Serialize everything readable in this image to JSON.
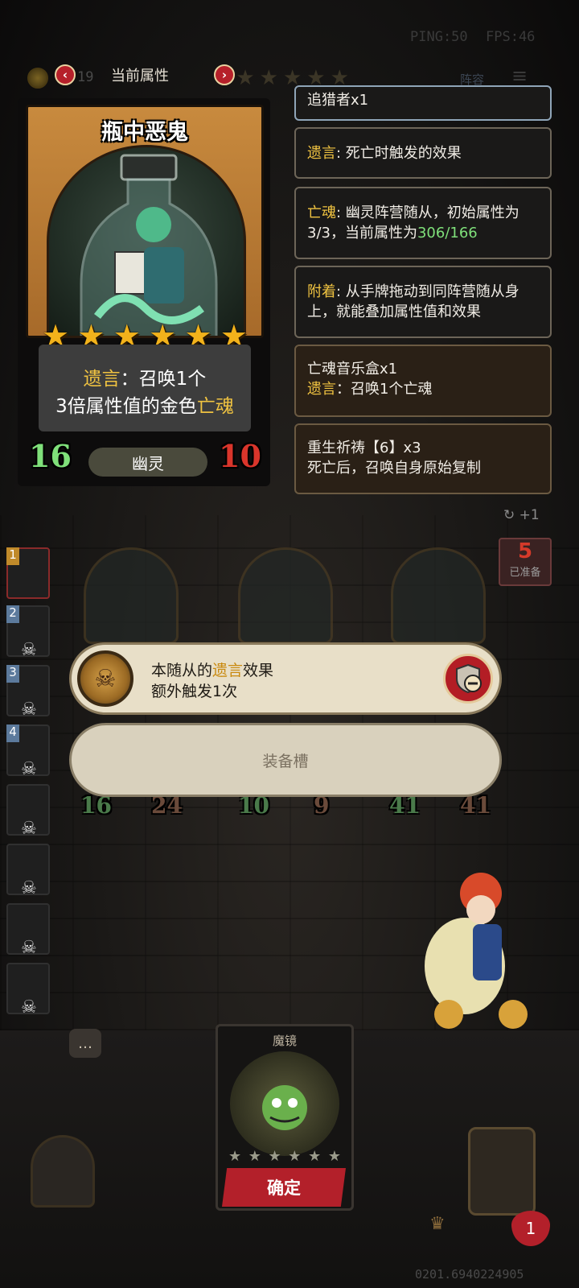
{
  "hud": {
    "ping": "PING:50",
    "fps": "FPS:46",
    "gold": "19",
    "lineup_label": "阵容",
    "tab_title": "当前属性",
    "prev_icon": "chevron-left-icon",
    "next_icon": "chevron-right-icon"
  },
  "card": {
    "name": "瓶中恶鬼",
    "stars": 6,
    "desc_kw": "遗言",
    "desc_line1": "：召唤1个",
    "desc_line2_pre": "3倍属性值的金色",
    "desc_line2_kw": "亡魂",
    "attack": "16",
    "health": "10",
    "tribe": "幽灵"
  },
  "panels": {
    "p0": {
      "text": "追猎者x1"
    },
    "p1": {
      "kw": "遗言",
      "text": ": 死亡时触发的效果"
    },
    "p2": {
      "kw": "亡魂",
      "text": ": 幽灵阵营随从，初始属性为3/3，当前属性为",
      "highlight": "306/166"
    },
    "p3": {
      "kw": "附着",
      "text": ": 从手牌拖动到同阵营随从身上，就能叠加属性值和效果"
    },
    "p4": {
      "title": "亡魂音乐盒x1",
      "kw": "遗言",
      "text": "：召唤1个亡魂"
    },
    "p5": {
      "title": "重生祈祷【6】x3",
      "text": "死亡后，召唤自身原始复制"
    }
  },
  "board": {
    "refresh_count": "+1",
    "ready_num": "5",
    "ready_label": "已准备",
    "slots": [
      {
        "atk": "16",
        "hp": "24"
      },
      {
        "atk": "10",
        "hp": "9"
      },
      {
        "atk": "41",
        "hp": "41"
      }
    ],
    "side_numbers": [
      "1",
      "2",
      "3",
      "4"
    ]
  },
  "popup": {
    "line1_pre": "本随从的",
    "line1_kw": "遗言",
    "line1_post": "效果",
    "line2": "额外触发1次",
    "equip_slot_label": "装备槽"
  },
  "mirror": {
    "label": "魔镜",
    "stars": 6,
    "confirm_label": "确定"
  },
  "footer": {
    "lives": "1",
    "build_id": "0201.6940224905"
  },
  "colors": {
    "accent_red": "#b3202a",
    "keyword_gold": "#f0c341",
    "stat_green": "#7fe07a",
    "health_red": "#d9352b"
  }
}
